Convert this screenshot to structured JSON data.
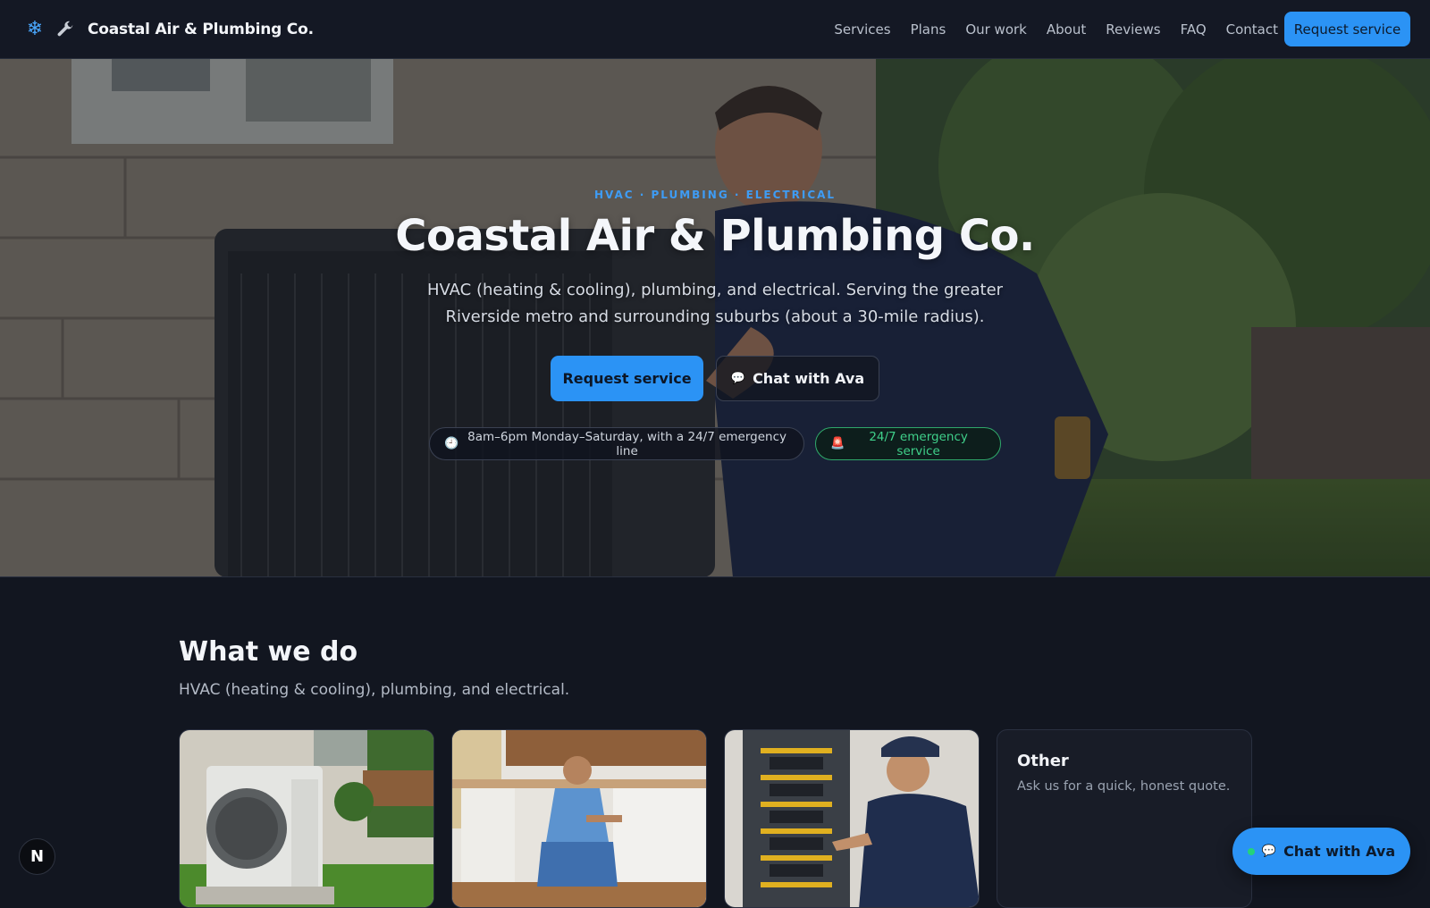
{
  "brand": {
    "name": "Coastal Air & Plumbing Co.",
    "icons": [
      "snowflake-icon",
      "wrench-icon"
    ]
  },
  "nav": {
    "links": [
      "Services",
      "Plans",
      "Our work",
      "About",
      "Reviews",
      "FAQ",
      "Contact"
    ],
    "cta": "Request service"
  },
  "hero": {
    "eyebrow": "HVAC · PLUMBING · ELECTRICAL",
    "title": "Coastal Air & Plumbing Co.",
    "subtitle": "HVAC (heating & cooling), plumbing, and electrical. Serving the greater Riverside metro and surrounding suburbs (about a 30-mile radius).",
    "primary_button": "Request service",
    "secondary_button": "Chat with Ava",
    "hours_pill": "8am–6pm Monday–Saturday, with a 24/7 emergency line",
    "emergency_pill": "24/7 emergency service"
  },
  "services": {
    "title": "What we do",
    "subtitle": "HVAC (heating & cooling), plumbing, and electrical.",
    "other_card": {
      "title": "Other",
      "subtitle": "Ask us for a quick, honest quote."
    }
  },
  "floating": {
    "badge": "N",
    "chat_button": "Chat with Ava"
  },
  "colors": {
    "accent": "#2b93f5",
    "background": "#121620",
    "emergency": "#3fd08a"
  }
}
